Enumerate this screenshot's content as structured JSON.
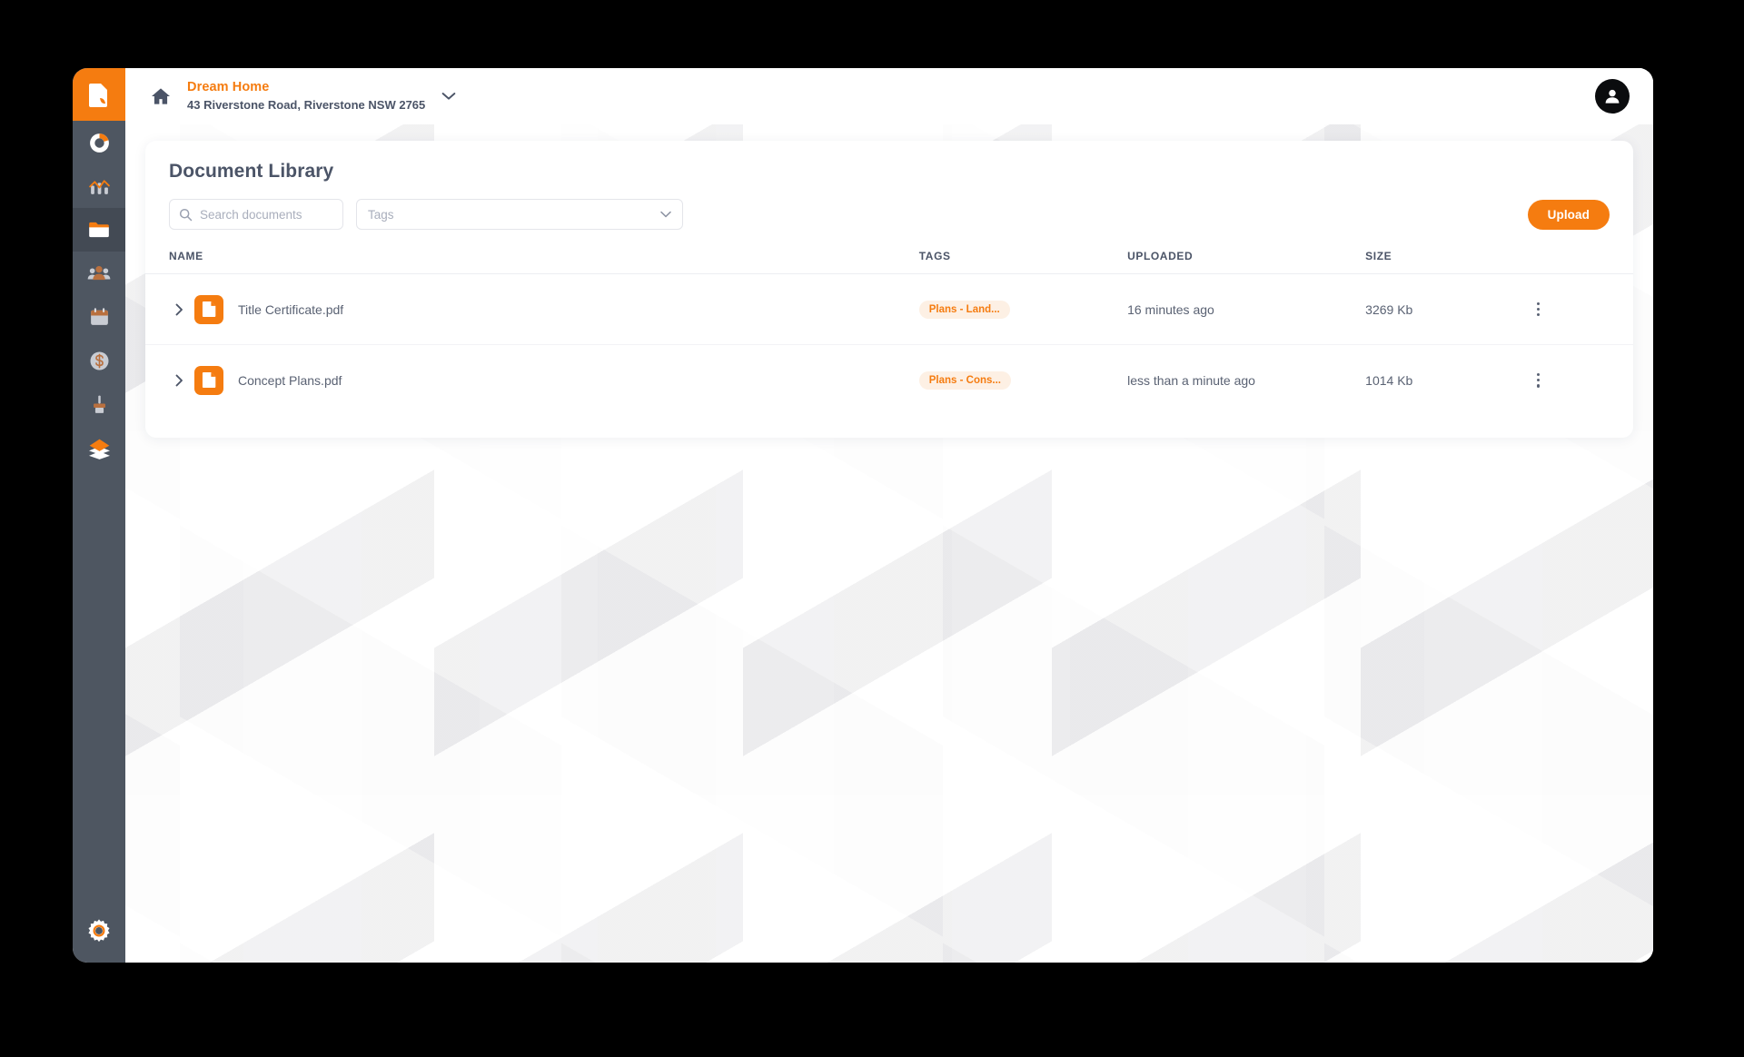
{
  "window": {
    "background_color": "#000000",
    "surface_color": "#ffffff"
  },
  "colors": {
    "accent": "#f57c10",
    "sidebar": "#4e5661",
    "sidebar_active": "#434a54",
    "text_primary": "#4b5467",
    "text_secondary": "#5a6273",
    "tag_bg": "#fdf0e4"
  },
  "sidebar": {
    "logo": {
      "name": "app-logo",
      "icon": "document-logo-icon"
    },
    "items": [
      {
        "icon": "donut-chart-icon",
        "name": "dashboard",
        "active": false
      },
      {
        "icon": "bar-chart-icon",
        "name": "analytics",
        "active": false
      },
      {
        "icon": "folder-icon",
        "name": "documents",
        "active": true
      },
      {
        "icon": "people-icon",
        "name": "contacts",
        "active": false
      },
      {
        "icon": "calendar-icon",
        "name": "schedule",
        "active": false
      },
      {
        "icon": "dollar-circle-icon",
        "name": "finance",
        "active": false
      },
      {
        "icon": "paint-brush-icon",
        "name": "selections",
        "active": false
      },
      {
        "icon": "layers-icon",
        "name": "stages",
        "active": false
      }
    ],
    "bottom": {
      "icon": "gear-icon",
      "name": "settings"
    }
  },
  "topbar": {
    "home_icon": "home-icon",
    "property_name": "Dream Home",
    "property_address": "43 Riverstone Road, Riverstone NSW 2765",
    "chevron_icon": "chevron-down-icon",
    "avatar_icon": "user-avatar-icon"
  },
  "library": {
    "title": "Document Library",
    "search": {
      "placeholder": "Search documents",
      "value": "",
      "icon": "search-icon"
    },
    "tags_filter": {
      "placeholder": "Tags",
      "value": "",
      "icon": "chevron-down-icon"
    },
    "upload_label": "Upload",
    "columns": {
      "name": "NAME",
      "tags": "TAGS",
      "uploaded": "UPLOADED",
      "size": "SIZE"
    },
    "rows": [
      {
        "expand_icon": "chevron-right-icon",
        "file_icon": "pdf-file-icon",
        "name": "Title Certificate.pdf",
        "tag": "Plans - Land...",
        "uploaded": "16 minutes ago",
        "size": "3269 Kb",
        "menu_icon": "kebab-menu-icon"
      },
      {
        "expand_icon": "chevron-right-icon",
        "file_icon": "pdf-file-icon",
        "name": "Concept Plans.pdf",
        "tag": "Plans - Cons...",
        "uploaded": "less than a minute ago",
        "size": "1014 Kb",
        "menu_icon": "kebab-menu-icon"
      }
    ]
  }
}
